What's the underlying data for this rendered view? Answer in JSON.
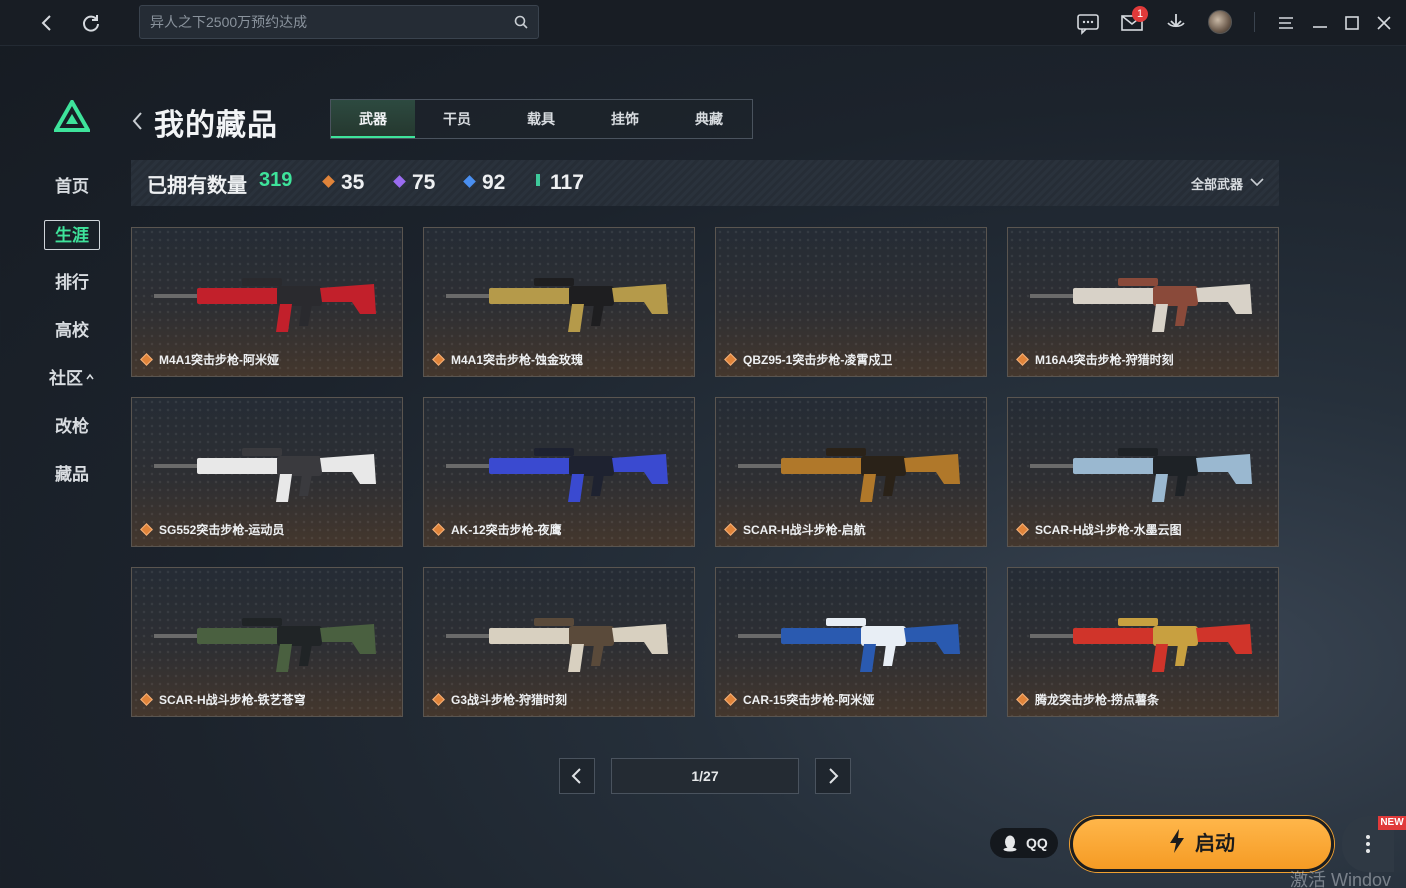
{
  "topbar": {
    "search_placeholder": "异人之下2500万预约达成",
    "mail_badge": "1"
  },
  "sidebar": {
    "items": [
      {
        "label": "首页",
        "active": false
      },
      {
        "label": "生涯",
        "active": true
      },
      {
        "label": "排行",
        "active": false
      },
      {
        "label": "高校",
        "active": false
      },
      {
        "label": "社区",
        "active": false
      },
      {
        "label": "改枪",
        "active": false
      },
      {
        "label": "藏品",
        "active": false
      }
    ]
  },
  "header": {
    "title": "我的藏品",
    "tabs": [
      "武器",
      "干员",
      "载具",
      "挂饰",
      "典藏"
    ],
    "active_tab": "武器"
  },
  "stats": {
    "owned_label": "已拥有数量",
    "owned_count": "319",
    "tiers": [
      {
        "value": "35",
        "color": "#e0843a"
      },
      {
        "value": "75",
        "color": "#9a6cf0"
      },
      {
        "value": "92",
        "color": "#4a8ff0"
      },
      {
        "value": "117",
        "color": "#3ec99b"
      }
    ],
    "filter_label": "全部武器"
  },
  "items": [
    {
      "name": "M4A1突击步枪-阿米娅",
      "accent": "#c2202b",
      "body": "#2a2a2e"
    },
    {
      "name": "M4A1突击步枪-蚀金玫瑰",
      "accent": "#b59a4a",
      "body": "#1e1e20"
    },
    {
      "name": "QBZ95-1突击步枪-凌霄戍卫",
      "accent": "",
      "body": ""
    },
    {
      "name": "M16A4突击步枪-狩猎时刻",
      "accent": "#d8d2c8",
      "body": "#8a4a3a"
    },
    {
      "name": "SG552突击步枪-运动员",
      "accent": "#e8e8e8",
      "body": "#3a3a3e"
    },
    {
      "name": "AK-12突击步枪-夜鹰",
      "accent": "#3a4ad0",
      "body": "#1e2230"
    },
    {
      "name": "SCAR-H战斗步枪-启航",
      "accent": "#b0782a",
      "body": "#2a2218"
    },
    {
      "name": "SCAR-H战斗步枪-水墨云图",
      "accent": "#9ab8d0",
      "body": "#1e2226"
    },
    {
      "name": "SCAR-H战斗步枪-铁艺苍穹",
      "accent": "#4a6040",
      "body": "#202426"
    },
    {
      "name": "G3战斗步枪-狩猎时刻",
      "accent": "#d8d0c0",
      "body": "#5a4a3a"
    },
    {
      "name": "CAR-15突击步枪-阿米娅",
      "accent": "#2a5ab0",
      "body": "#e8eef5"
    },
    {
      "name": "腾龙突击步枪-捞点薯条",
      "accent": "#d0342a",
      "body": "#c8a040"
    }
  ],
  "pagination": {
    "page": "1/27"
  },
  "footer": {
    "qq_label": "QQ",
    "launch_label": "启动",
    "new_tag": "NEW",
    "watermark": "激活 Windov"
  }
}
